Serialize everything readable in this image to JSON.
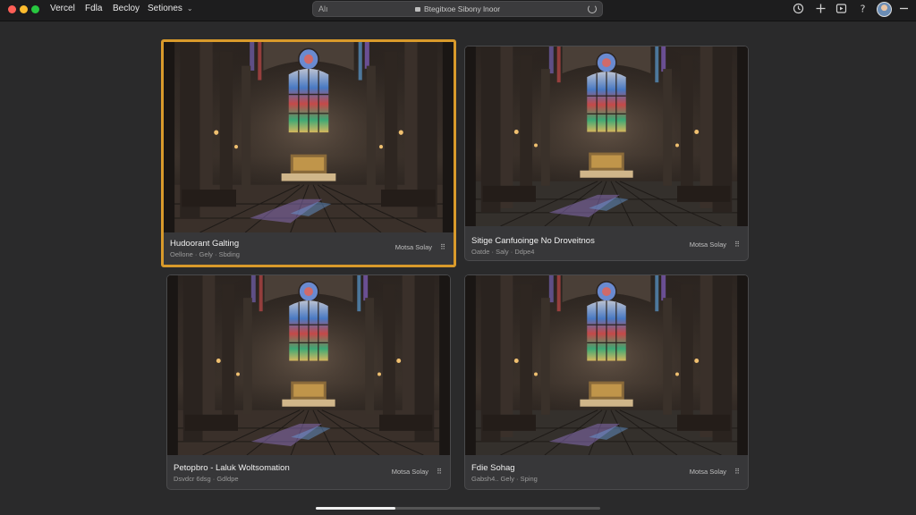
{
  "menu": {
    "items": [
      "Vercel",
      "Fdla",
      "Becloy",
      "Setiones"
    ]
  },
  "urlbar": {
    "left_text": "Alı",
    "address": "Btegitxoe Sibony lnoor"
  },
  "toolbar_icons": [
    "history-icon",
    "plus-icon",
    "play-icon",
    "help-icon",
    "minimize-icon"
  ],
  "cards": [
    {
      "title": "Hudoorant Galting",
      "meta": "Oellone · Gely · Sbding",
      "action": "Motsa Solay",
      "selected": true
    },
    {
      "title": "Sitige Canfuoinge No Droveitnos",
      "meta": "Oatde · Saly · Ddpe4",
      "action": "Motsa Solay",
      "selected": false
    },
    {
      "title": "Petopbro - Laluk Woltsomation",
      "meta": "Dsvdcr 6dsg · Gdldpe",
      "action": "Motsa Solay",
      "selected": false
    },
    {
      "title": "Fdie Sohag",
      "meta": "Gabsh4.. Gely · Sping",
      "action": "Motsa Solay",
      "selected": false
    }
  ],
  "scroll": {
    "progress": 0.28
  },
  "colors": {
    "accent": "#d99a2b",
    "background": "#2a2a2b",
    "card": "#373739"
  }
}
